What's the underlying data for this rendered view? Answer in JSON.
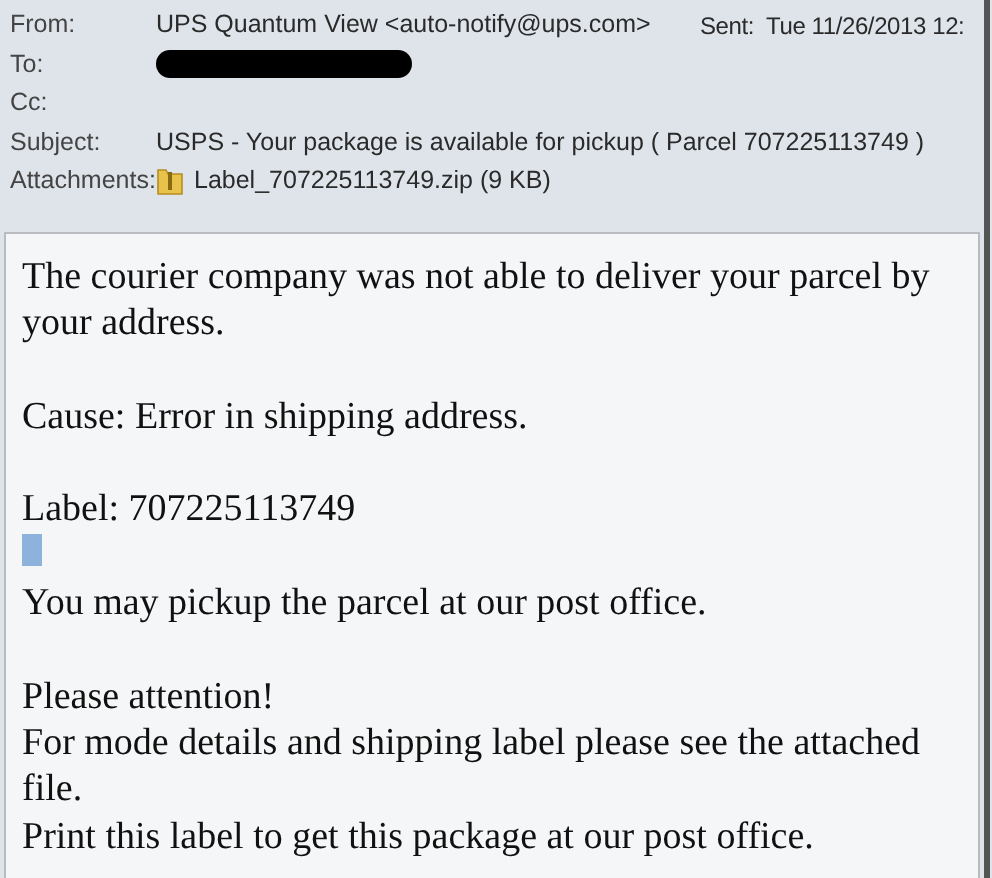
{
  "header": {
    "fields": [
      {
        "label": "From:",
        "kind": "text",
        "value": "UPS Quantum View <auto-notify@ups.com>"
      },
      {
        "label": "To:",
        "kind": "redacted"
      },
      {
        "label": "Cc:",
        "kind": "empty"
      },
      {
        "label": "Subject:",
        "kind": "text",
        "value": "USPS - Your package is available for pickup ( Parcel 707225113749 )"
      },
      {
        "label": "Attachments:",
        "kind": "attachment",
        "value": "Label_707225113749.zip (9 KB)"
      }
    ],
    "sent": {
      "label": "Sent:",
      "value": "Tue 11/26/2013 12:"
    }
  },
  "body": {
    "blocks": [
      {
        "kind": "paragraph",
        "text": "The courier company was not able to deliver your parcel by your address."
      },
      {
        "kind": "paragraph",
        "text": "Cause: Error in shipping address."
      },
      {
        "kind": "line",
        "text": "Label: 707225113749"
      },
      {
        "kind": "cursor"
      },
      {
        "kind": "paragraph",
        "text": "You may pickup the parcel at our post office."
      },
      {
        "kind": "line",
        "text": "Please attention!"
      },
      {
        "kind": "line",
        "text": "For mode details and shipping label please see the attached file."
      },
      {
        "kind": "line",
        "text": "Print this label to get this package at our post office."
      }
    ]
  }
}
